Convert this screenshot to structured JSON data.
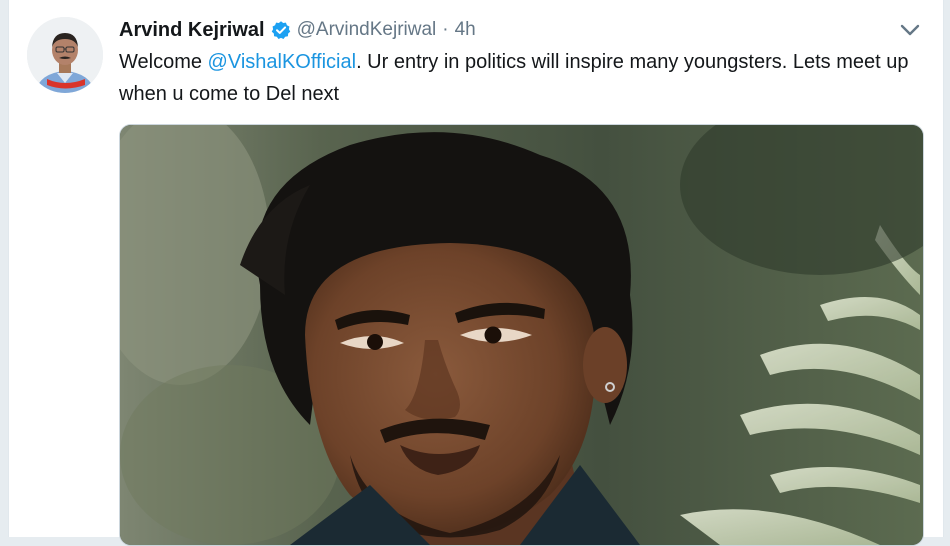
{
  "tweet": {
    "author_name": "Arvind Kejriwal",
    "handle": "@ArvindKejriwal",
    "separator": "·",
    "time": "4h",
    "text_prefix": "Welcome ",
    "mention": "@VishalKOfficial",
    "text_suffix": ". Ur entry in politics will inspire many youngsters. Lets meet up when u come to Del next",
    "verified_icon": "verified-badge-icon",
    "caret_icon": "chevron-down-icon",
    "colors": {
      "text": "#14171a",
      "secondary": "#657786",
      "link": "#1b95e0",
      "verified": "#1da1f2"
    }
  }
}
